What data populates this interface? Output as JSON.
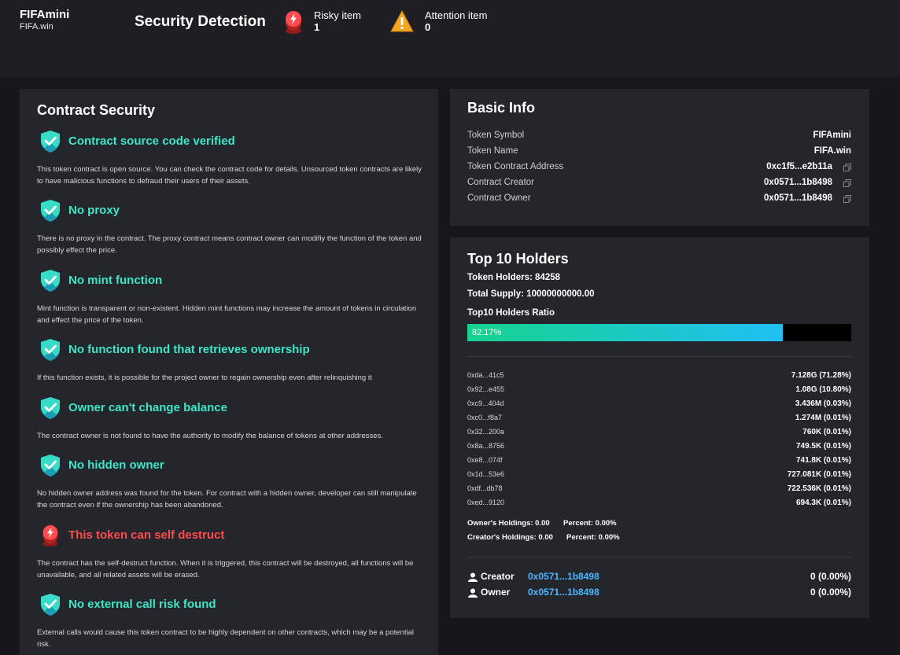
{
  "header": {
    "brand_name": "FIFAmini",
    "brand_sub": "FIFA.win",
    "title": "Security Detection",
    "risky_label": "Risky item",
    "risky_count": "1",
    "attention_label": "Attention item",
    "attention_count": "0"
  },
  "contract_security": {
    "title": "Contract Security",
    "items": [
      {
        "title": "Contract source code verified",
        "status": "safe",
        "desc": "This token contract is open source. You can check the contract code for details. Unsourced token contracts are likely to have malicious functions to defraud their users of their assets."
      },
      {
        "title": "No proxy",
        "status": "safe",
        "desc": "There is no proxy in the contract. The proxy contract means contract owner can modifiy the function of the token and possibly effect the price."
      },
      {
        "title": "No mint function",
        "status": "safe",
        "desc": "Mint function is transparent or non-existent. Hidden mint functions may increase the amount of tokens in circulation and effect the price of the token."
      },
      {
        "title": "No function found that retrieves ownership",
        "status": "safe",
        "desc": "If this function exists, it is possible for the project owner to regain ownership even after relinquishing it"
      },
      {
        "title": "Owner can't change balance",
        "status": "safe",
        "desc": "The contract owner is not found to have the authority to modify the balance of tokens at other addresses."
      },
      {
        "title": "No hidden owner",
        "status": "safe",
        "desc": "No hidden owner address was found for the token. For contract with a hidden owner, developer can still manipulate the contract even if the ownership has been abandoned."
      },
      {
        "title": "This token can self destruct",
        "status": "risk",
        "desc": "The contract has the self-destruct function. When it is triggered, this contract will be destroyed, all functions will be unavailable, and all related assets will be erased."
      },
      {
        "title": "No external call risk found",
        "status": "safe",
        "desc": "External calls would cause this token contract to be highly dependent on other contracts, which may be a potential risk."
      }
    ]
  },
  "basic_info": {
    "title": "Basic Info",
    "rows": [
      {
        "label": "Token Symbol",
        "value": "FIFAmini"
      },
      {
        "label": "Token Name",
        "value": "FIFA.win"
      },
      {
        "label": "Token Contract Address",
        "value": "0xc1f5...e2b11a"
      },
      {
        "label": "Contract Creator",
        "value": "0x0571...1b8498"
      },
      {
        "label": "Contract Owner",
        "value": "0x0571...1b8498"
      }
    ]
  },
  "holders": {
    "title": "Top 10 Holders",
    "token_holders": "Token Holders: 84258",
    "total_supply": "Total Supply: 10000000000.00",
    "ratio_label": "Top10 Holders Ratio",
    "ratio_text": "82.17%",
    "ratio_value": 0.8217,
    "list": [
      {
        "addr": "0xda...41c5",
        "amount": "7.128G  (71.28%)"
      },
      {
        "addr": "0x92...e455",
        "amount": "1.08G  (10.80%)"
      },
      {
        "addr": "0xc9...404d",
        "amount": "3.436M  (0.03%)"
      },
      {
        "addr": "0xc0...f8a7",
        "amount": "1.274M  (0.01%)"
      },
      {
        "addr": "0x32...200a",
        "amount": "760K  (0.01%)"
      },
      {
        "addr": "0x8a...8756",
        "amount": "749.5K  (0.01%)"
      },
      {
        "addr": "0xe8...074f",
        "amount": "741.8K  (0.01%)"
      },
      {
        "addr": "0x1d...53e6",
        "amount": "727.081K  (0.01%)"
      },
      {
        "addr": "0xdf...db78",
        "amount": "722.536K  (0.01%)"
      },
      {
        "addr": "0xed...9120",
        "amount": "694.3K  (0.01%)"
      }
    ],
    "owner_holdings": "Owner's Holdings: 0.00",
    "owner_percent": "Percent: 0.00%",
    "creator_holdings": "Creator's Holdings: 0.00",
    "creator_percent": "Percent: 0.00%",
    "creator": {
      "label": "Creator",
      "addr": "0x0571...1b8498",
      "value": "0  (0.00%)"
    },
    "owner": {
      "label": "Owner",
      "addr": "0x0571...1b8498",
      "value": "0  (0.00%)"
    }
  },
  "colors": {
    "safe": "#3ee6c8",
    "risk": "#ff4d4f",
    "link": "#4db8ff",
    "attention": "#f5a623"
  }
}
